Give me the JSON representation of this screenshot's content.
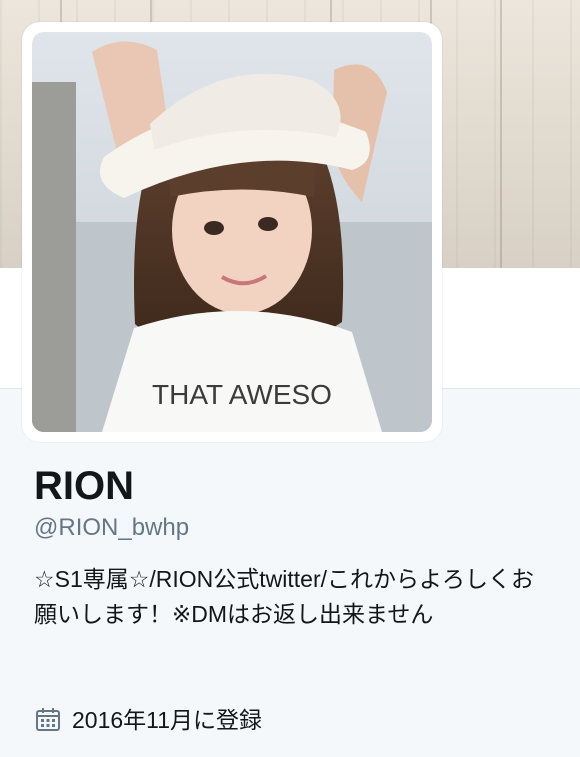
{
  "profile": {
    "name": "RION",
    "handle": "@RION_bwhp",
    "bio": "☆S1専属☆/RION公式twitter/これからよろしくお願いします！※DMはお返し出来ません",
    "joined": "2016年11月に登録",
    "avatar_text": "THAT AWESO"
  },
  "icons": {
    "joined": "calendar-icon"
  },
  "colors": {
    "name": "#14171a",
    "handle": "#657786",
    "background": "#f5f8fa",
    "divider": "#e1e8ed"
  }
}
